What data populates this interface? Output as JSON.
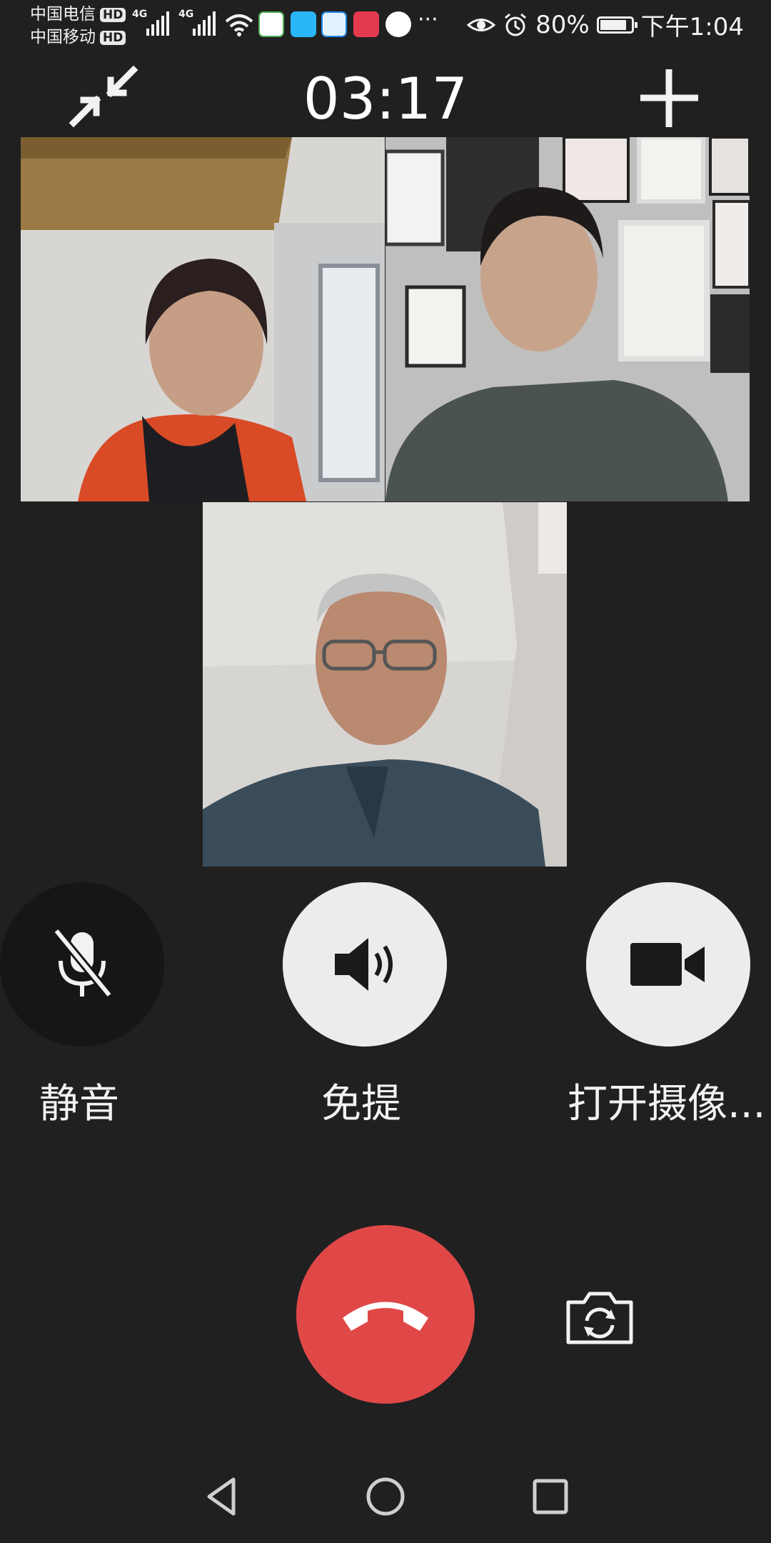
{
  "status_bar": {
    "carrier_1": "中国电信",
    "carrier_2": "中国移动",
    "hd_badge": "HD",
    "network": "4G",
    "battery": "80%",
    "time": "下午1:04"
  },
  "call": {
    "duration": "03:17"
  },
  "controls": {
    "mute_label": "静音",
    "speaker_label": "免提",
    "camera_label": "打开摄像..."
  },
  "colors": {
    "background": "#202020",
    "end_call": "#e04848",
    "button_light": "#ececec",
    "button_dark": "#161616"
  },
  "icons": [
    "minimize-icon",
    "add-participant-icon",
    "mic-off-icon",
    "speaker-icon",
    "video-camera-icon",
    "hang-up-icon",
    "switch-camera-icon",
    "back-icon",
    "home-icon",
    "recents-icon"
  ]
}
